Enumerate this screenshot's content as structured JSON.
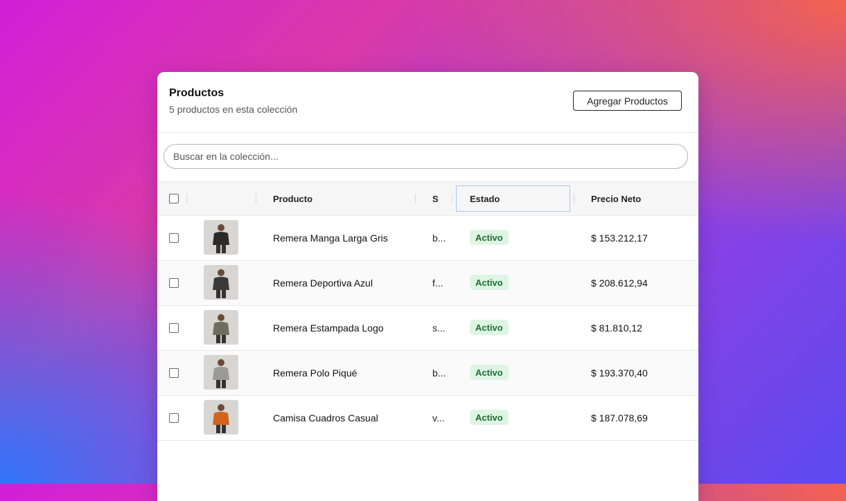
{
  "card": {
    "title": "Productos",
    "subtitle": "5 productos en esta colección",
    "add_button_label": "Agregar Productos"
  },
  "search": {
    "placeholder": "Buscar en la colección..."
  },
  "table": {
    "columns": {
      "producto": "Producto",
      "s": "S",
      "estado": "Estado",
      "precio": "Precio Neto"
    },
    "rows": [
      {
        "name": "Remera Manga Larga Gris",
        "s": "b...",
        "status": "Activo",
        "price": "$ 153.212,17",
        "thumb_color": "#2b2b2b"
      },
      {
        "name": "Remera Deportiva Azul",
        "s": "f...",
        "status": "Activo",
        "price": "$ 208.612,94",
        "thumb_color": "#3a3a3a"
      },
      {
        "name": "Remera Estampada Logo",
        "s": "s...",
        "status": "Activo",
        "price": "$ 81.810,12",
        "thumb_color": "#6d6e5e"
      },
      {
        "name": "Remera Polo Piqué",
        "s": "b...",
        "status": "Activo",
        "price": "$ 193.370,40",
        "thumb_color": "#9a9a98"
      },
      {
        "name": "Camisa Cuadros Casual",
        "s": "v...",
        "status": "Activo",
        "price": "$ 187.078,69",
        "thumb_color": "#d2641e"
      }
    ]
  },
  "colors": {
    "badge_bg": "#dff5e4",
    "badge_text": "#1c6f33",
    "selected_header_border": "#a9c8ef"
  }
}
